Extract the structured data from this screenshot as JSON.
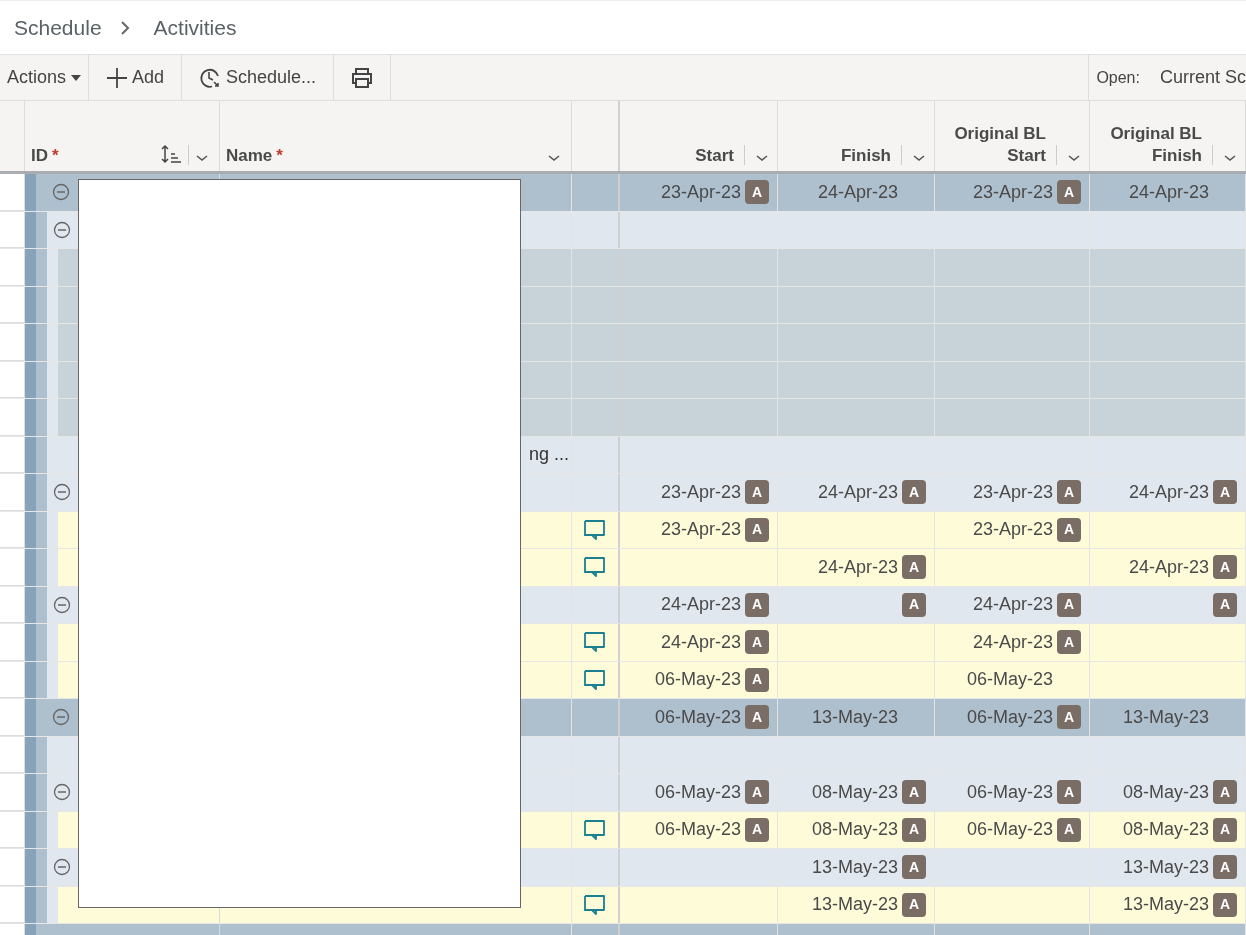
{
  "breadcrumb": [
    "Schedule",
    "Activities"
  ],
  "toolbar": {
    "actions": "Actions",
    "add": "Add",
    "schedule": "Schedule...",
    "open_label": "Open:",
    "open_value": "Current Sc"
  },
  "columns": [
    {
      "label": "ID",
      "mark": "*"
    },
    {
      "label": "Name",
      "mark": "*"
    },
    {
      "label": "Start"
    },
    {
      "label": "Finish"
    },
    {
      "label": "Original BL",
      "label2": "Start"
    },
    {
      "label": "Original BL",
      "label2": "Finish"
    }
  ],
  "rows": [
    {
      "kind": "group1",
      "expanded": true,
      "cells": [
        {
          "date": "23-Apr-23",
          "badge": "A"
        },
        {
          "date": "24-Apr-23"
        },
        {
          "date": "23-Apr-23",
          "badge": "A"
        },
        {
          "date": "24-Apr-23"
        }
      ]
    },
    {
      "kind": "group2",
      "expanded": true,
      "cells": []
    },
    {
      "kind": "filler",
      "cells": []
    },
    {
      "kind": "filler",
      "cells": []
    },
    {
      "kind": "filler",
      "cells": []
    },
    {
      "kind": "filler",
      "cells": []
    },
    {
      "kind": "filler",
      "cells": []
    },
    {
      "kind": "blank",
      "name": "ng ...",
      "cells": []
    },
    {
      "kind": "group2",
      "expanded": true,
      "cells": [
        {
          "date": "23-Apr-23",
          "badge": "A"
        },
        {
          "date": "24-Apr-23",
          "badge": "A"
        },
        {
          "date": "23-Apr-23",
          "badge": "A"
        },
        {
          "date": "24-Apr-23",
          "badge": "A"
        }
      ]
    },
    {
      "kind": "task",
      "cells": [
        {
          "date": "23-Apr-23",
          "badge": "A"
        },
        {},
        {
          "date": "23-Apr-23",
          "badge": "A"
        },
        {}
      ]
    },
    {
      "kind": "task",
      "cells": [
        {},
        {
          "date": "24-Apr-23",
          "badge": "A"
        },
        {},
        {
          "date": "24-Apr-23",
          "badge": "A"
        }
      ]
    },
    {
      "kind": "group2",
      "expanded": true,
      "cells": [
        {
          "date": "24-Apr-23",
          "badge": "A"
        },
        {
          "badge": "A"
        },
        {
          "date": "24-Apr-23",
          "badge": "A"
        },
        {
          "badge": "A"
        }
      ]
    },
    {
      "kind": "task",
      "cells": [
        {
          "date": "24-Apr-23",
          "badge": "A"
        },
        {},
        {
          "date": "24-Apr-23",
          "badge": "A"
        },
        {}
      ]
    },
    {
      "kind": "task",
      "cells": [
        {
          "date": "06-May-23",
          "badge": "A"
        },
        {},
        {
          "date": "06-May-23"
        },
        {}
      ]
    },
    {
      "kind": "group1",
      "expanded": true,
      "cells": [
        {
          "date": "06-May-23",
          "badge": "A"
        },
        {
          "date": "13-May-23"
        },
        {
          "date": "06-May-23",
          "badge": "A"
        },
        {
          "date": "13-May-23"
        }
      ]
    },
    {
      "kind": "blank",
      "cells": []
    },
    {
      "kind": "group2",
      "expanded": true,
      "cells": [
        {
          "date": "06-May-23",
          "badge": "A"
        },
        {
          "date": "08-May-23",
          "badge": "A"
        },
        {
          "date": "06-May-23",
          "badge": "A"
        },
        {
          "date": "08-May-23",
          "badge": "A"
        }
      ]
    },
    {
      "kind": "task",
      "cells": [
        {
          "date": "06-May-23",
          "badge": "A"
        },
        {
          "date": "08-May-23",
          "badge": "A"
        },
        {
          "date": "06-May-23",
          "badge": "A"
        },
        {
          "date": "08-May-23",
          "badge": "A"
        }
      ]
    },
    {
      "kind": "group2",
      "expanded": true,
      "cells": [
        {},
        {
          "date": "13-May-23",
          "badge": "A"
        },
        {},
        {
          "date": "13-May-23",
          "badge": "A"
        }
      ]
    },
    {
      "kind": "task",
      "cells": [
        {},
        {
          "date": "13-May-23",
          "badge": "A"
        },
        {},
        {
          "date": "13-May-23",
          "badge": "A"
        }
      ]
    },
    {
      "kind": "group1",
      "cells": []
    }
  ]
}
